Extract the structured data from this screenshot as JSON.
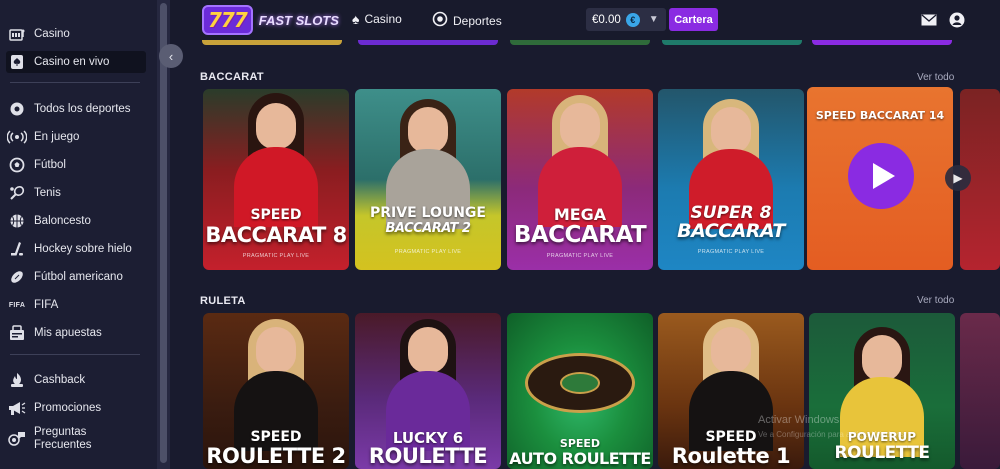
{
  "sidebar": {
    "items": [
      {
        "label": "Casino",
        "icon": "slot-machine-icon"
      },
      {
        "label": "Casino en vivo",
        "icon": "spade-card-icon"
      },
      {
        "label": "Todos los deportes",
        "icon": "all-sports-icon"
      },
      {
        "label": "En juego",
        "icon": "live-signal-icon"
      },
      {
        "label": "Fútbol",
        "icon": "soccer-ball-icon"
      },
      {
        "label": "Tenis",
        "icon": "tennis-icon"
      },
      {
        "label": "Baloncesto",
        "icon": "basketball-icon"
      },
      {
        "label": "Hockey sobre hielo",
        "icon": "hockey-stick-icon"
      },
      {
        "label": "Fútbol americano",
        "icon": "american-football-icon"
      },
      {
        "label": "FIFA",
        "icon": "fifa-logo-icon"
      },
      {
        "label": "Mis apuestas",
        "icon": "bets-icon"
      },
      {
        "label": "Cashback",
        "icon": "cashback-icon"
      },
      {
        "label": "Promociones",
        "icon": "megaphone-icon"
      },
      {
        "label": "Preguntas Frecuentes",
        "icon": "faq-icon"
      }
    ]
  },
  "header": {
    "logo_sevens": "777",
    "logo_text": "FAST SLOTS",
    "nav_casino": "Casino",
    "nav_deportes": "Deportes",
    "balance": "€0.00",
    "currency_symbol": "€",
    "cartera_label": "Cartera"
  },
  "sections": {
    "baccarat": {
      "title": "BACCARAT",
      "see_all": "Ver todo",
      "cards": [
        {
          "line1": "SPEED",
          "line2": "BACCARAT 8",
          "provider": "PRAGMATIC PLAY LIVE",
          "bg": "#b9222d"
        },
        {
          "line1": "PRIVE LOUNGE",
          "line2": "BACCARAT 2",
          "provider": "PRAGMATIC PLAY LIVE",
          "bg": "#2f7f7a"
        },
        {
          "line1": "MEGA",
          "line2": "BACCARAT",
          "provider": "PRAGMATIC PLAY LIVE",
          "bg": "#8e2a8f"
        },
        {
          "line1": "SUPER 8",
          "line2": "BACCARAT",
          "provider": "PRAGMATIC PLAY LIVE",
          "bg": "#1a6fa8"
        },
        {
          "line1": "SPEED BACCARAT 14",
          "line2": "",
          "provider": "",
          "bg": "#e0662a"
        }
      ]
    },
    "ruleta": {
      "title": "RULETA",
      "see_all": "Ver todo",
      "cards": [
        {
          "line1": "SPEED",
          "line2": "ROULETTE 2",
          "bg": "#7a3b16"
        },
        {
          "line1": "LUCKY 6",
          "line2": "ROULETTE",
          "bg": "#6a2a8f"
        },
        {
          "line1": "SPEED",
          "line2": "AUTO ROULETTE",
          "bg": "#1b8f3e"
        },
        {
          "line1": "SPEED",
          "line2": "Roulette 1",
          "bg": "#7b3a12"
        },
        {
          "line1": "POWERUP",
          "line2": "ROULETTE",
          "bg": "#1a5e35"
        }
      ]
    }
  },
  "watermark": {
    "line1": "Activar Windows",
    "line2": "Ve a Configuración para activar Windows."
  }
}
